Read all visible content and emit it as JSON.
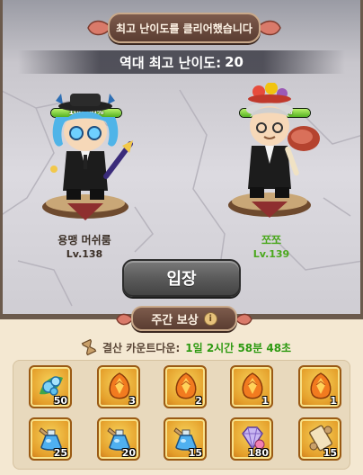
{
  "header": {
    "title": "최고 난이도를 클리어했습니다",
    "record_label": "역대 최고 난이도:",
    "record_value": "20"
  },
  "characters": [
    {
      "name": "용맹 머쉬룸",
      "level": "Lv.138",
      "hp_text": "100.00%",
      "hp_fraction": 1.0,
      "name_color": "#3b2f26",
      "level_color": "#3b2f26"
    },
    {
      "name": "쪼쪼",
      "level": "Lv.139",
      "hp_text": "100.00%",
      "hp_fraction": 1.0,
      "name_color": "#4aa81c",
      "level_color": "#4aa81c"
    }
  ],
  "enter_button": {
    "label": "입장"
  },
  "weekly": {
    "tab_label": "주간 보상",
    "info_icon": "i",
    "countdown_label": "결산 카운트다운:",
    "countdown_value": "1일 2시간 58분 48초"
  },
  "rewards": [
    {
      "icon": "blue-gem-cluster-icon",
      "qty": "50"
    },
    {
      "icon": "orange-crystal-egg-icon",
      "qty": "3"
    },
    {
      "icon": "orange-crystal-egg-icon",
      "qty": "2"
    },
    {
      "icon": "orange-crystal-egg-icon",
      "qty": "1"
    },
    {
      "icon": "orange-crystal-egg-icon",
      "qty": "1"
    },
    {
      "icon": "blue-potion-flask-icon",
      "qty": "25"
    },
    {
      "icon": "blue-potion-flask-icon",
      "qty": "20"
    },
    {
      "icon": "blue-potion-flask-icon",
      "qty": "15"
    },
    {
      "icon": "purple-gem-icon",
      "qty": "180"
    },
    {
      "icon": "scroll-icon",
      "qty": "15"
    }
  ],
  "colors": {
    "banner": "#5a3d31",
    "panel": "#f4e8d2",
    "countdown": "#2e9a12",
    "hp": "#54b121"
  }
}
